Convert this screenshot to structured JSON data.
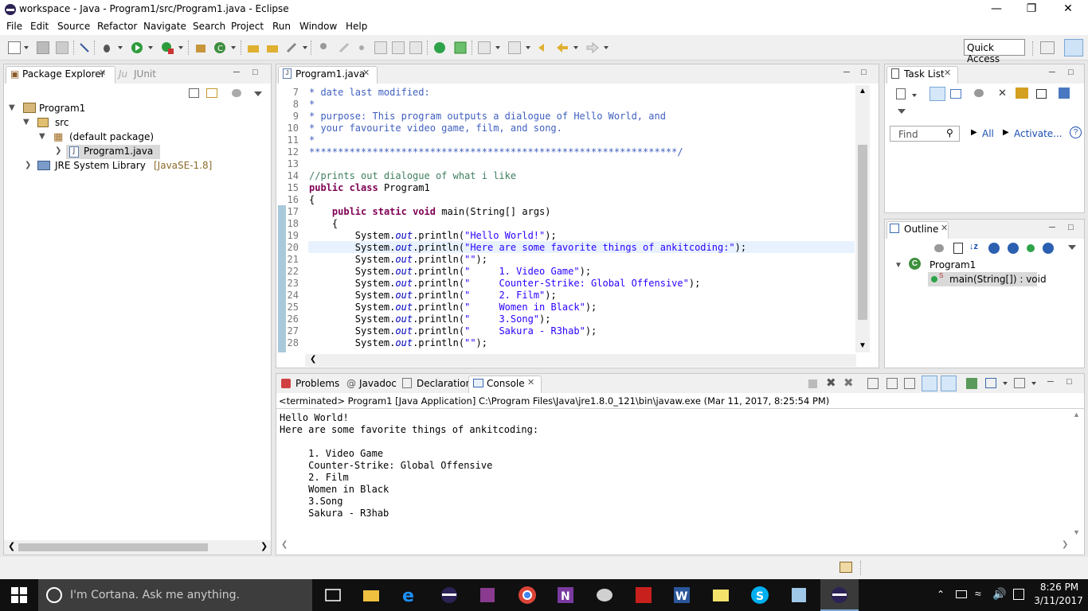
{
  "window": {
    "title": "workspace - Java - Program1/src/Program1.java - Eclipse",
    "minimize": "—",
    "restore": "❐",
    "close": "✕"
  },
  "menu": [
    "File",
    "Edit",
    "Source",
    "Refactor",
    "Navigate",
    "Search",
    "Project",
    "Run",
    "Window",
    "Help"
  ],
  "toolbar": {
    "quick_access": "Quick Access"
  },
  "package_explorer": {
    "tab_label": "Package Explorer",
    "junit_tab_label": "JUnit",
    "junit_prefix": "Ju",
    "tree": {
      "project": "Program1",
      "src": "src",
      "package": "(default package)",
      "file": "Program1.java",
      "jre": "JRE System Library",
      "jre_version": "[JavaSE-1.8]"
    }
  },
  "editor": {
    "tab_label": "Program1.java",
    "lines": [
      {
        "n": "7",
        "text": "* date last modified:"
      },
      {
        "n": "8",
        "text": "*"
      },
      {
        "n": "9",
        "text": "* purpose: This program outputs a dialogue of Hello World, and"
      },
      {
        "n": "10",
        "text": "* your favourite video game, film, and song."
      },
      {
        "n": "11",
        "text": "*"
      },
      {
        "n": "12",
        "text": "****************************************************************/"
      },
      {
        "n": "13",
        "text": ""
      },
      {
        "n": "14",
        "text": "//prints out dialogue of what i like"
      },
      {
        "n": "15",
        "text": "public class Program1"
      },
      {
        "n": "16",
        "text": "{"
      },
      {
        "n": "17",
        "text": "    public static void main(String[] args)"
      },
      {
        "n": "18",
        "text": "    {"
      },
      {
        "n": "19",
        "text": "        System.out.println(\"Hello World!\");"
      },
      {
        "n": "20",
        "text": "        System.out.println(\"Here are some favorite things of ankitcoding:\");"
      },
      {
        "n": "21",
        "text": "        System.out.println(\"\");"
      },
      {
        "n": "22",
        "text": "        System.out.println(\"     1. Video Game\");"
      },
      {
        "n": "23",
        "text": "        System.out.println(\"     Counter-Strike: Global Offensive\");"
      },
      {
        "n": "24",
        "text": "        System.out.println(\"     2. Film\");"
      },
      {
        "n": "25",
        "text": "        System.out.println(\"     Women in Black\");"
      },
      {
        "n": "26",
        "text": "        System.out.println(\"     3.Song\");"
      },
      {
        "n": "27",
        "text": "        System.out.println(\"     Sakura - R3hab\");"
      },
      {
        "n": "28",
        "text": "        System.out.println(\"\");"
      }
    ]
  },
  "task_list": {
    "tab_label": "Task List",
    "find_placeholder": "Find",
    "all_label": "All",
    "activate_label": "Activate..."
  },
  "outline": {
    "tab_label": "Outline",
    "class_name": "Program1",
    "method": "main(String[]) : void"
  },
  "bottom_tabs": {
    "problems": "Problems",
    "javadoc": "Javadoc",
    "declaration": "Declaration",
    "console": "Console"
  },
  "console": {
    "header": "<terminated> Program1 [Java Application] C:\\Program Files\\Java\\jre1.8.0_121\\bin\\javaw.exe (Mar 11, 2017, 8:25:54 PM)",
    "output": [
      "Hello World!",
      "Here are some favorite things of ankitcoding:",
      "",
      "     1. Video Game",
      "     Counter-Strike: Global Offensive",
      "     2. Film",
      "     Women in Black",
      "     3.Song",
      "     Sakura - R3hab"
    ]
  },
  "taskbar": {
    "cortana": "I'm Cortana. Ask me anything.",
    "time": "8:26 PM",
    "date": "3/11/2017"
  }
}
